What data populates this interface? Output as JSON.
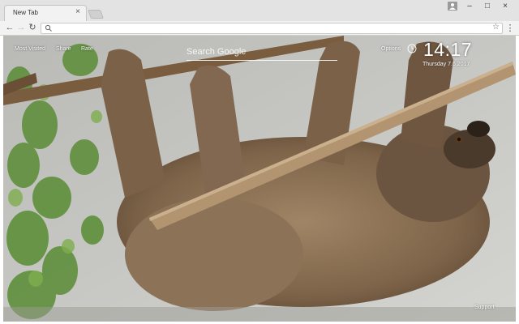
{
  "browser": {
    "tab_title": "New Tab",
    "tab_close": "×",
    "address_value": "",
    "bookmark_star": "☆",
    "nav": {
      "back": "←",
      "forward": "→",
      "reload": "↻"
    },
    "window": {
      "minimize": "–",
      "maximize": "□",
      "close": "×"
    },
    "menu": "⋮",
    "icons": [
      "profile-icon",
      "search-icon",
      "star-icon",
      "menu-icon",
      "clock-icon"
    ]
  },
  "newtab": {
    "top_links": [
      "Most Visited",
      "Share",
      "Rate"
    ],
    "search_placeholder": "Search Google",
    "options_label": "Options",
    "clock": {
      "time": "14:17",
      "date": "Thursday  7.6.2017"
    },
    "support_label": "Support",
    "background_description_colors": {
      "wall": "#c8c8c6",
      "ivy": "#5f8f3c",
      "branch": "#8a6b4b",
      "sloth_fur": "#8b7355"
    }
  }
}
